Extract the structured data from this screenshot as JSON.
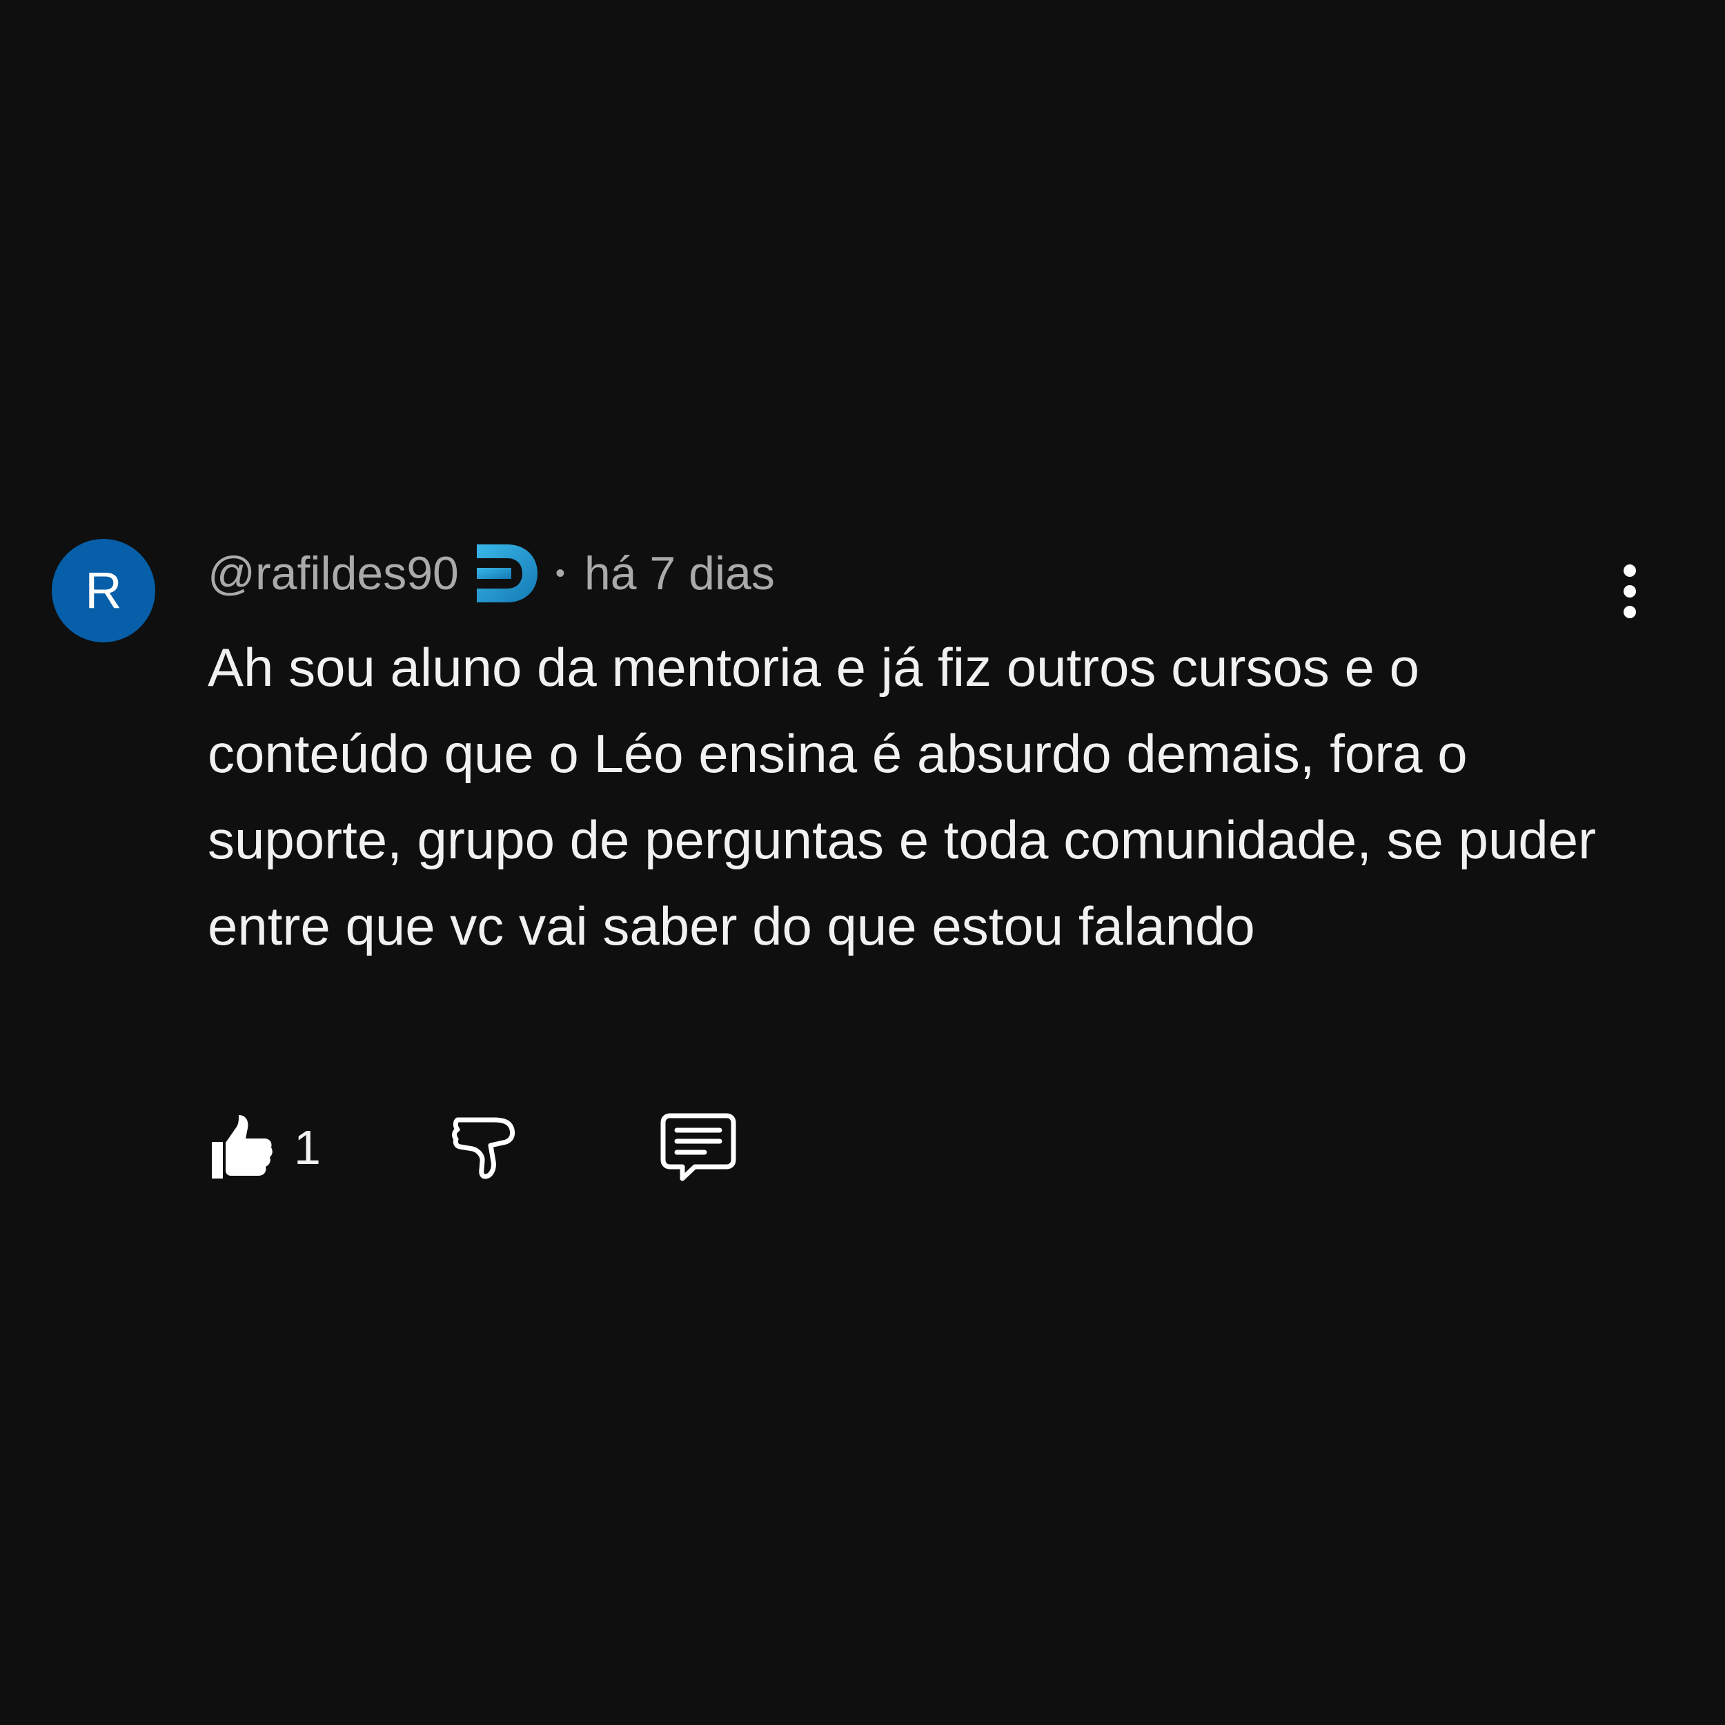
{
  "comment": {
    "author": {
      "avatar_initial": "R",
      "handle": "@rafildes90",
      "badge_icon": "member-badge-icon"
    },
    "separator": "•",
    "time": "há 7 dias",
    "text": "Ah sou aluno da mentoria e já fiz outros cursos e o conteúdo que o Léo ensina é absurdo demais, fora o suporte, grupo de perguntas e toda comunidade, se puder entre que vc vai saber do que estou falando",
    "actions": {
      "like_count": "1",
      "like_icon": "thumbs-up-icon",
      "dislike_icon": "thumbs-down-icon",
      "reply_icon": "reply-comment-icon",
      "menu_icon": "more-vertical-icon"
    }
  },
  "colors": {
    "background": "#0f0f0f",
    "avatar": "#065fa8",
    "secondary_text": "#aaaaaa",
    "primary_text": "#f1f1f1",
    "badge_accent": "#2a9fd8"
  }
}
